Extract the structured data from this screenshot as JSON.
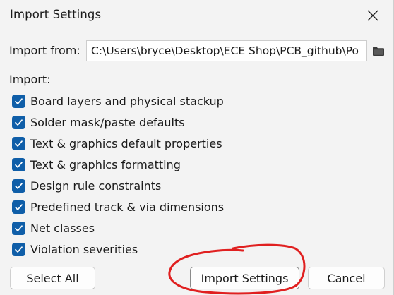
{
  "window": {
    "title": "Import Settings"
  },
  "import_from": {
    "label": "Import from:",
    "path": "C:\\Users\\bryce\\Desktop\\ECE Shop\\PCB_github\\Po"
  },
  "import_section": {
    "label": "Import:",
    "options": [
      {
        "label": "Board layers and physical stackup",
        "checked": true
      },
      {
        "label": "Solder mask/paste defaults",
        "checked": true
      },
      {
        "label": "Text & graphics default properties",
        "checked": true
      },
      {
        "label": "Text & graphics formatting",
        "checked": true
      },
      {
        "label": "Design rule constraints",
        "checked": true
      },
      {
        "label": "Predefined track & via dimensions",
        "checked": true
      },
      {
        "label": "Net classes",
        "checked": true
      },
      {
        "label": "Violation severities",
        "checked": true
      }
    ]
  },
  "buttons": {
    "select_all": "Select All",
    "import_settings": "Import Settings",
    "cancel": "Cancel"
  },
  "colors": {
    "checkbox": "#0f5ea8",
    "annotation": "#e02020"
  },
  "icons": {
    "close": "close-icon",
    "browse": "folder-icon",
    "check": "check-icon"
  }
}
